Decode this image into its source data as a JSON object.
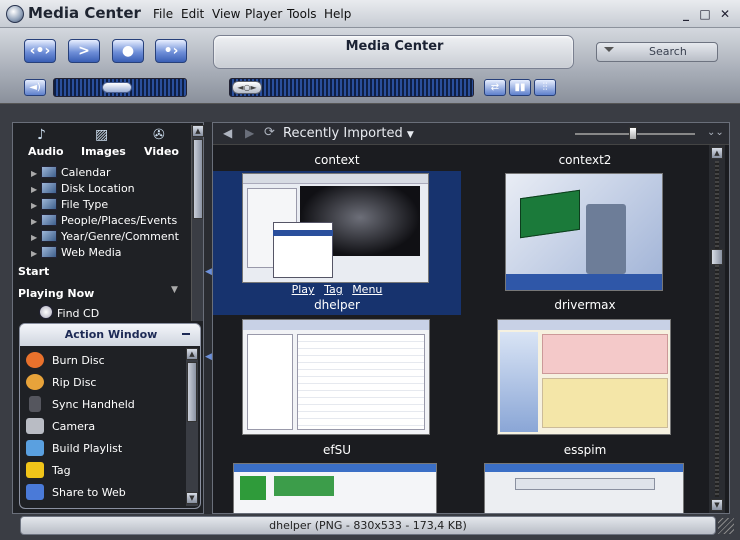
{
  "window": {
    "title": "Media Center",
    "menu": [
      "File",
      "Edit",
      "View",
      "Player",
      "Tools",
      "Help"
    ],
    "controls": [
      "_",
      "□",
      "✕"
    ]
  },
  "toolbar": {
    "display_title": "Media Center",
    "search_placeholder": "Search",
    "transport": [
      "previous",
      "play",
      "stop",
      "next"
    ]
  },
  "library": {
    "tabs": [
      {
        "label": "Audio",
        "icon": "music-note-icon"
      },
      {
        "label": "Images",
        "icon": "images-icon"
      },
      {
        "label": "Video",
        "icon": "film-reel-icon"
      }
    ],
    "tree": [
      {
        "label": "Calendar"
      },
      {
        "label": "Disk Location"
      },
      {
        "label": "File Type"
      },
      {
        "label": "People/Places/Events"
      },
      {
        "label": "Year/Genre/Comment"
      },
      {
        "label": "Web Media"
      }
    ],
    "start_label": "Start",
    "playing_now_label": "Playing Now",
    "find_cd_label": "Find CD"
  },
  "action_window": {
    "title": "Action Window",
    "items": [
      {
        "label": "Burn Disc",
        "icon": "burn-disc-icon",
        "color": "#e8712c"
      },
      {
        "label": "Rip Disc",
        "icon": "rip-disc-icon",
        "color": "#e8a33a"
      },
      {
        "label": "Sync Handheld",
        "icon": "handheld-icon",
        "color": "#3a3a44"
      },
      {
        "label": "Camera",
        "icon": "camera-icon",
        "color": "#b9bcc4"
      },
      {
        "label": "Build Playlist",
        "icon": "playlist-icon",
        "color": "#5aa0e0"
      },
      {
        "label": "Tag",
        "icon": "tag-icon",
        "color": "#f0c419"
      },
      {
        "label": "Share to Web",
        "icon": "share-web-icon",
        "color": "#4a7ad8"
      }
    ]
  },
  "browser": {
    "view_label": "Recently Imported",
    "captions_top": [
      "context",
      "context2"
    ],
    "items": [
      {
        "name": "dhelper",
        "selected": true
      },
      {
        "name": "drivermax",
        "selected": false
      },
      {
        "name": "efSU",
        "selected": false
      },
      {
        "name": "esspim",
        "selected": false
      }
    ],
    "selected_actions": [
      "Play",
      "Tag",
      "Menu"
    ]
  },
  "status": {
    "text": "dhelper (PNG - 830x533 - 173,4 KB)"
  }
}
